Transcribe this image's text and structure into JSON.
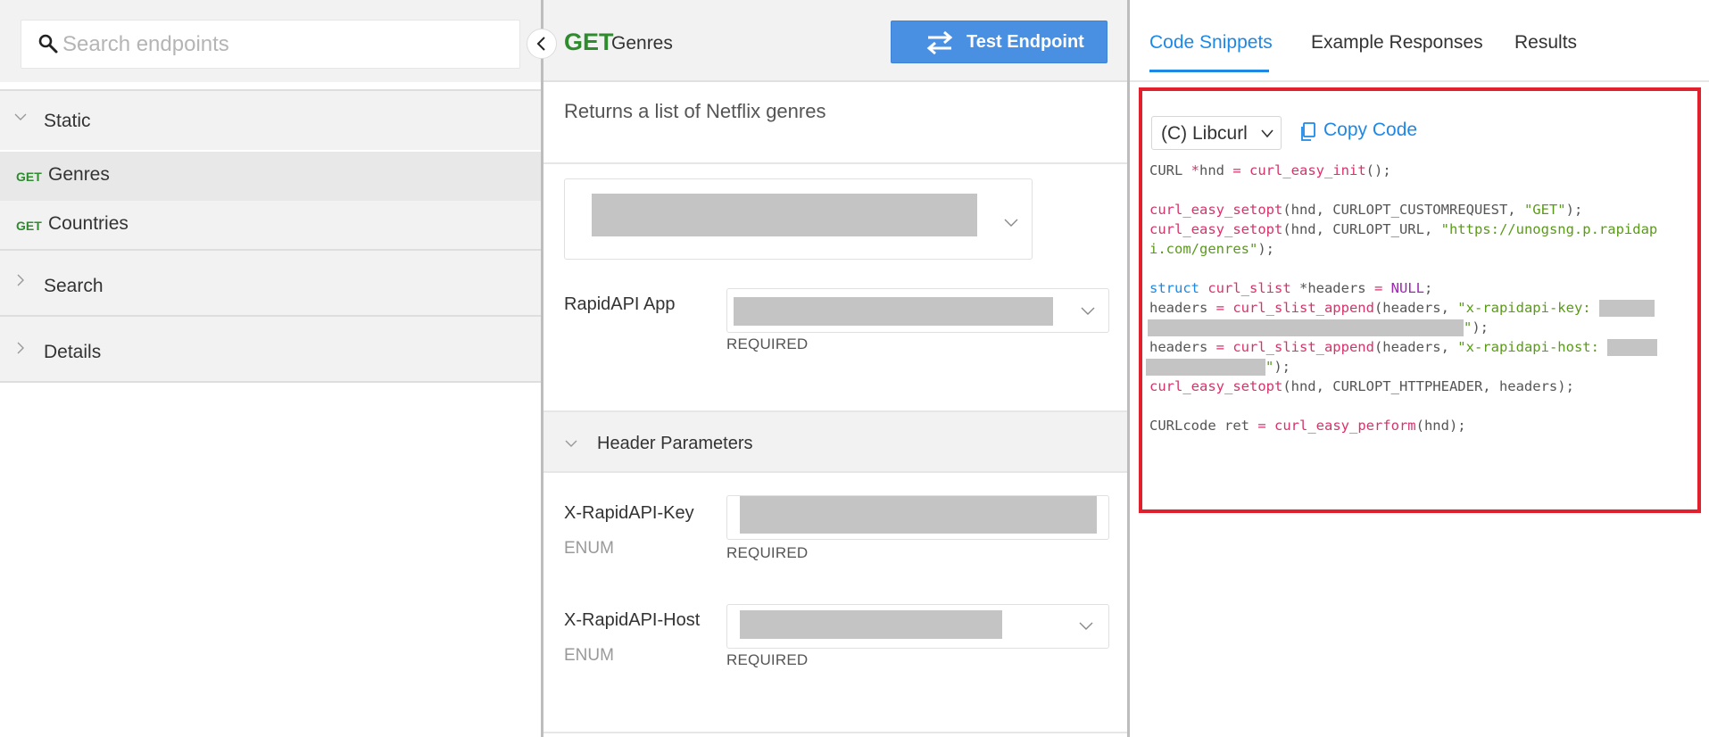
{
  "sidebar": {
    "search_placeholder": "Search endpoints",
    "groups": [
      {
        "label": "Static",
        "expanded": true
      },
      {
        "label": "Search",
        "expanded": false
      },
      {
        "label": "Details",
        "expanded": false
      }
    ],
    "endpoints": [
      {
        "method": "GET",
        "name": "Genres",
        "selected": true
      },
      {
        "method": "GET",
        "name": "Countries",
        "selected": false
      }
    ]
  },
  "endpoint": {
    "method": "GET",
    "name": "Genres",
    "test_button": "Test Endpoint",
    "description": "Returns a list of Netflix genres",
    "app_label": "RapidAPI App",
    "required": "REQUIRED",
    "header_params_title": "Header Parameters",
    "params": [
      {
        "name": "X-RapidAPI-Key",
        "type": "ENUM",
        "required": "REQUIRED"
      },
      {
        "name": "X-RapidAPI-Host",
        "type": "ENUM",
        "required": "REQUIRED"
      }
    ]
  },
  "right": {
    "tabs": [
      "Code Snippets",
      "Example Responses",
      "Results"
    ],
    "active_tab": "Code Snippets",
    "language": "(C) Libcurl",
    "copy_label": "Copy Code",
    "code": {
      "l1": {
        "a": "CURL ",
        "b": "*",
        "c": "hnd ",
        "d": "= ",
        "e": "curl_easy_init",
        "f": "();"
      },
      "l3": {
        "fn": "curl_easy_setopt",
        "a": "(hnd, CURLOPT_CUSTOMREQUEST, ",
        "s": "\"GET\"",
        "z": ");"
      },
      "l4": {
        "fn": "curl_easy_setopt",
        "a": "(hnd, CURLOPT_URL, ",
        "s": "\"https://unogsng.p.rapidap"
      },
      "l5": {
        "s": "i.com/genres\"",
        "z": ");"
      },
      "l7": {
        "kw": "struct ",
        "fn": "curl_slist ",
        "a": "*headers ",
        "op": "= ",
        "nul": "NULL",
        "z": ";"
      },
      "l8": {
        "a": "headers ",
        "op": "= ",
        "fn": "curl_slist_append",
        "b": "(headers, ",
        "s": "\"x-rapidapi-key: "
      },
      "l9": {
        "s": "\"",
        "z": ");"
      },
      "l10": {
        "a": "headers ",
        "op": "= ",
        "fn": "curl_slist_append",
        "b": "(headers, ",
        "s": "\"x-rapidapi-host: "
      },
      "l11": {
        "s": "\"",
        "z": ");"
      },
      "l12": {
        "fn": "curl_easy_setopt",
        "a": "(hnd, CURLOPT_HTTPHEADER, headers);"
      },
      "l14": {
        "a": "CURLcode ret ",
        "op": "= ",
        "fn": "curl_easy_perform",
        "z": "(hnd);"
      }
    }
  },
  "colors": {
    "accent": "#1e88e5",
    "get_method": "#2e8b2e",
    "test_button": "#4a90e2",
    "highlight_border": "#e0202c"
  }
}
